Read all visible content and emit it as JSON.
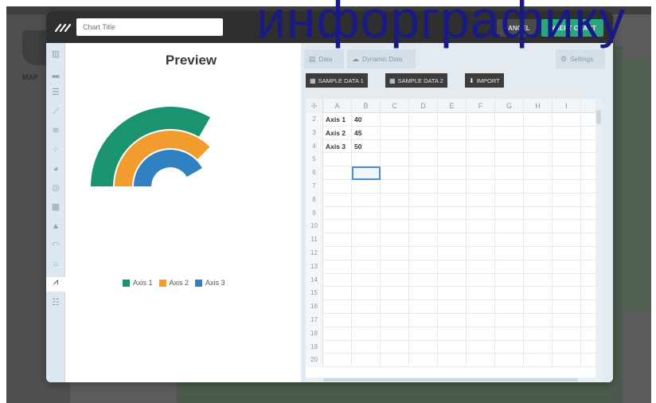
{
  "headline": "инфорграфику",
  "backdrop": {
    "map_label": "MAP"
  },
  "modal": {
    "title_placeholder": "Chart Title",
    "cancel_label": "CANCEL",
    "insert_label": "INSERT CHART"
  },
  "sidebar_icons": [
    "bar-chart-icon",
    "column-chart-icon",
    "horizontal-bar-icon",
    "line-chart-icon",
    "area-chart-icon",
    "scatter-chart-icon",
    "pie-chart-icon",
    "donut-chart-icon",
    "table-chart-icon",
    "pyramid-chart-icon",
    "gauge-chart-icon",
    "ring-chart-icon",
    "radial-chart-icon",
    "map-chart-icon"
  ],
  "preview": {
    "title": "Preview"
  },
  "tabs": {
    "data": "Data",
    "dynamic": "Dynamic Data",
    "settings": "Settings"
  },
  "buttons": {
    "sample1": "SAMPLE DATA 1",
    "sample2": "SAMPLE DATA 2",
    "import": "IMPORT"
  },
  "sheet": {
    "columns": [
      "A",
      "B",
      "C",
      "D",
      "E",
      "F",
      "G",
      "H",
      "I"
    ],
    "rows": [
      {
        "num": "2",
        "a": "Axis 1",
        "b": "40"
      },
      {
        "num": "3",
        "a": "Axis 2",
        "b": "45"
      },
      {
        "num": "4",
        "a": "Axis 3",
        "b": "50"
      },
      {
        "num": "5",
        "a": "",
        "b": ""
      },
      {
        "num": "6",
        "a": "",
        "b": ""
      },
      {
        "num": "7",
        "a": "",
        "b": ""
      },
      {
        "num": "8",
        "a": "",
        "b": ""
      },
      {
        "num": "9",
        "a": "",
        "b": ""
      },
      {
        "num": "10",
        "a": "",
        "b": ""
      },
      {
        "num": "11",
        "a": "",
        "b": ""
      },
      {
        "num": "12",
        "a": "",
        "b": ""
      },
      {
        "num": "13",
        "a": "",
        "b": ""
      },
      {
        "num": "14",
        "a": "",
        "b": ""
      },
      {
        "num": "15",
        "a": "",
        "b": ""
      },
      {
        "num": "16",
        "a": "",
        "b": ""
      },
      {
        "num": "17",
        "a": "",
        "b": ""
      },
      {
        "num": "18",
        "a": "",
        "b": ""
      },
      {
        "num": "19",
        "a": "",
        "b": ""
      },
      {
        "num": "20",
        "a": "",
        "b": ""
      }
    ]
  },
  "colors": {
    "axis1": "#1a9371",
    "axis2": "#f29c2f",
    "axis3": "#3180c1",
    "accent": "#2ba580"
  },
  "chart_data": {
    "type": "radial-bar",
    "categories": [
      "Axis 1",
      "Axis 2",
      "Axis 3"
    ],
    "values": [
      40,
      45,
      50
    ],
    "legend": [
      "Axis 1",
      "Axis 2",
      "Axis 3"
    ],
    "legend_position": "bottom",
    "title": "Preview"
  }
}
